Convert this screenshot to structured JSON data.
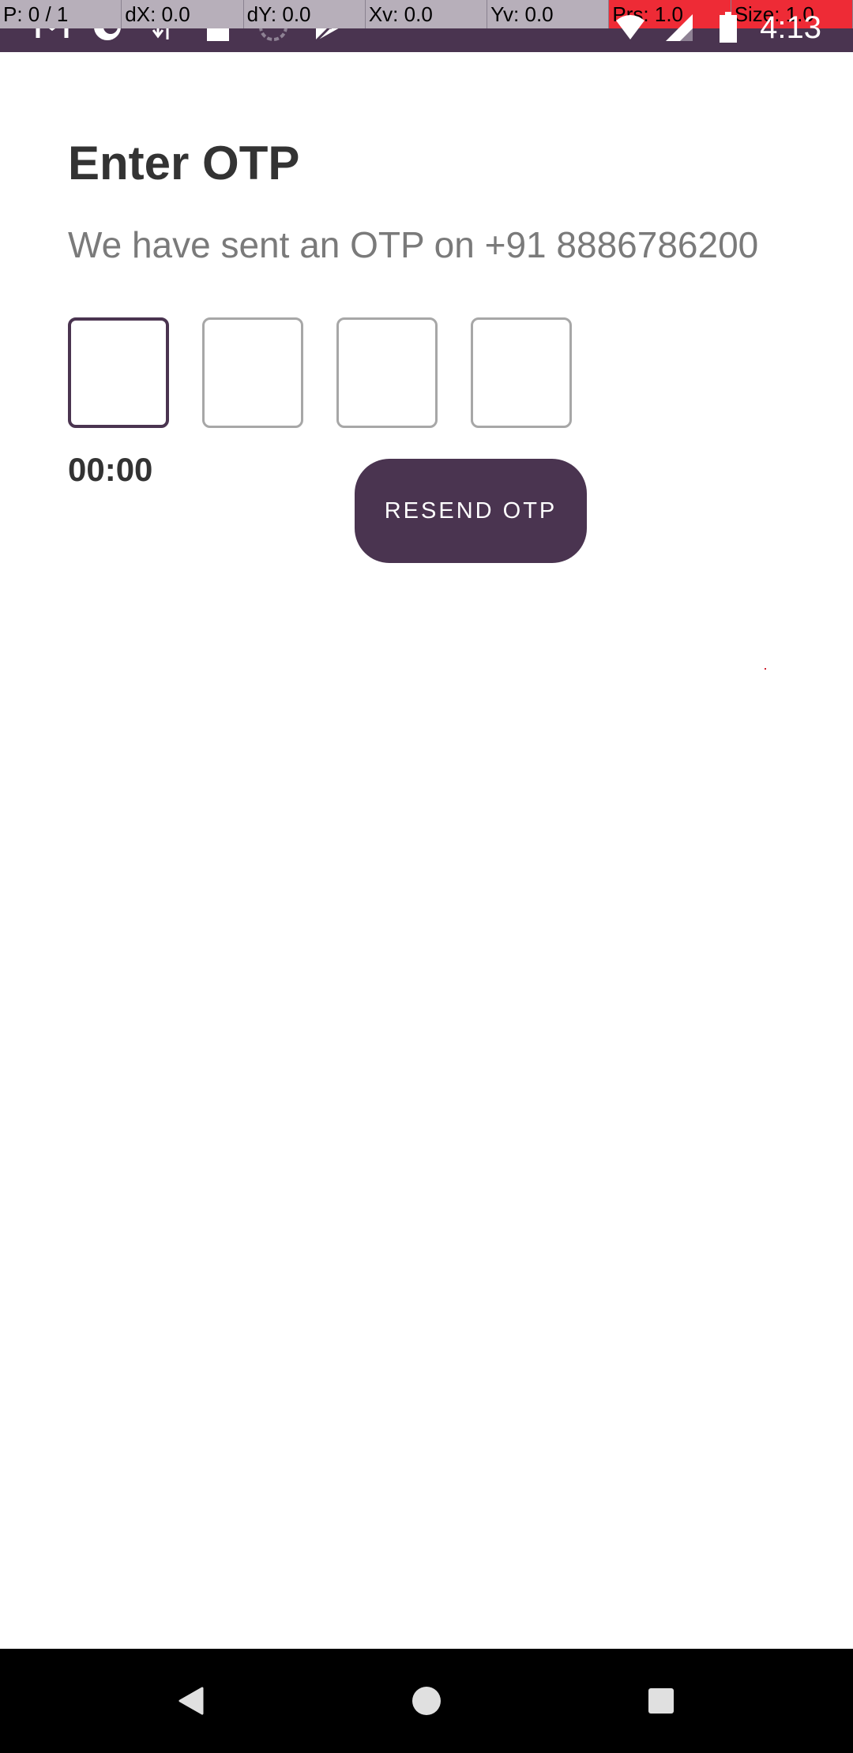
{
  "status_bar": {
    "debug": {
      "pointer": "P: 0 / 1",
      "dx": "dX: 0.0",
      "dy": "dY: 0.0",
      "xv": "Xv: 0.0",
      "yv": "Yv: 0.0",
      "prs": "Prs: 1.0",
      "size": "Size: 1.0"
    },
    "time": "4:13",
    "icons": [
      "gmail-icon",
      "sync-icon",
      "download-icon",
      "sd-card-icon",
      "loading-icon",
      "play-store-icon",
      "wifi-icon",
      "signal-icon",
      "battery-icon"
    ],
    "colors": {
      "background": "#4a3450",
      "debug_alert": "#ee2b36"
    }
  },
  "screen": {
    "title": "Enter OTP",
    "subtitle": "We have sent an OTP on +91 8886786200",
    "otp_fields": [
      "",
      "",
      "",
      ""
    ],
    "timer": "00:00",
    "resend_label": "RESEND OTP"
  },
  "nav_bar": {
    "icons": [
      "back-icon",
      "home-icon",
      "recents-icon"
    ]
  },
  "colors": {
    "accent": "#4a3450",
    "title_text": "#333333",
    "subtitle_text": "#7a7a7a",
    "otp_border": "#a7a7a7"
  }
}
